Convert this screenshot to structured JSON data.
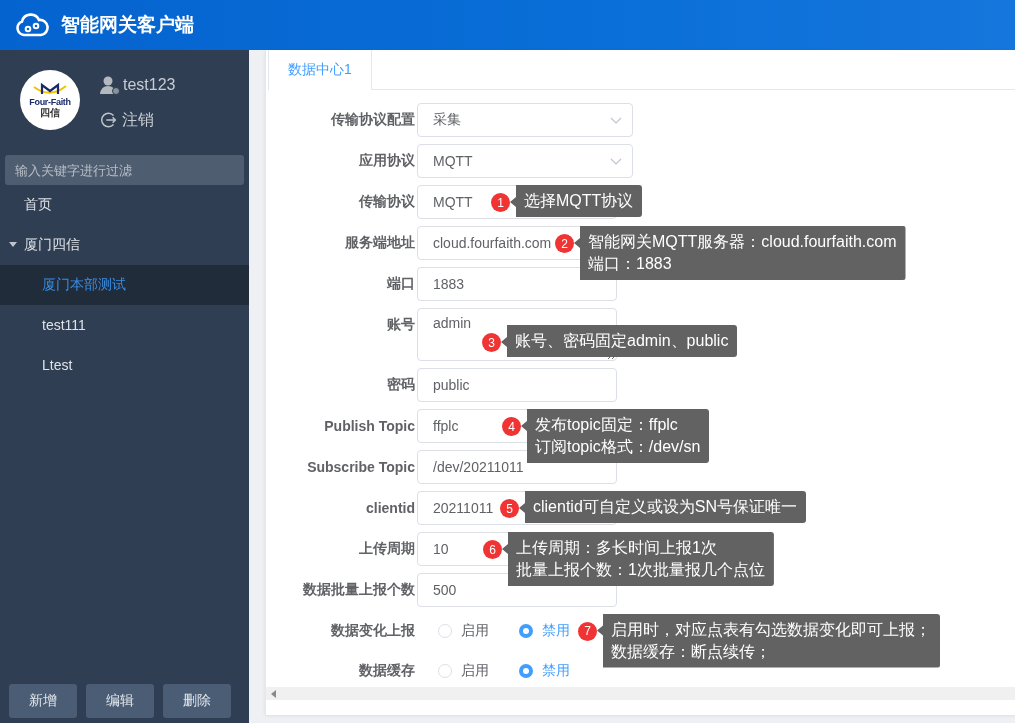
{
  "app": {
    "title": "智能网关客户端"
  },
  "user": {
    "name": "test123",
    "logout": "注销",
    "logo": {
      "name": "Four-Faith",
      "subname": "四信"
    }
  },
  "filter": {
    "placeholder": "输入关键字进行过滤"
  },
  "tree": [
    {
      "label": "首页",
      "selected": false
    },
    {
      "label": "厦门四信",
      "selected": false,
      "expanded": true,
      "children": [
        {
          "label": "厦门本部测试",
          "selected": true
        },
        {
          "label": "test111",
          "selected": false
        },
        {
          "label": "Ltest",
          "selected": false
        }
      ]
    }
  ],
  "buttons": [
    "新增",
    "编辑",
    "删除"
  ],
  "tabs": [
    {
      "label": "数据中心1",
      "selected": true
    }
  ],
  "form": {
    "fields": [
      {
        "label": "传输协议配置",
        "kind": "select",
        "value": "采集"
      },
      {
        "label": "应用协议",
        "kind": "select",
        "value": "MQTT"
      },
      {
        "label": "传输协议",
        "kind": "input",
        "value": "MQTT",
        "note": {
          "number": "1",
          "lines": [
            "选择MQTT协议"
          ]
        }
      },
      {
        "label": "服务端地址",
        "kind": "input",
        "value": "cloud.fourfaith.com",
        "note": {
          "number": "2",
          "lines": [
            "智能网关MQTT服务器：cloud.fourfaith.com",
            "端口：1883"
          ]
        }
      },
      {
        "label": "端口",
        "kind": "input",
        "value": "1883"
      },
      {
        "label": "账号",
        "kind": "textarea",
        "value": "admin",
        "note": {
          "number": "3",
          "lines": [
            "账号、密码固定admin、public"
          ]
        }
      },
      {
        "label": "密码",
        "kind": "input",
        "value": "public"
      },
      {
        "label": "Publish Topic",
        "kind": "input",
        "value": "ffplc",
        "note": {
          "number": "4",
          "lines": [
            "发布topic固定：ffplc",
            "订阅topic格式：/dev/sn"
          ]
        }
      },
      {
        "label": "Subscribe Topic",
        "kind": "input",
        "value": "/dev/20211011"
      },
      {
        "label": "clientid",
        "kind": "input",
        "value": "20211011",
        "note": {
          "number": "5",
          "lines": [
            "clientid可自定义或设为SN号保证唯一"
          ]
        }
      },
      {
        "label": "上传周期",
        "kind": "input",
        "value": "10",
        "note": {
          "number": "6",
          "lines": [
            "上传周期：多长时间上报1次",
            "批量上报个数：1次批量报几个点位"
          ]
        }
      },
      {
        "label": "数据批量上报个数",
        "kind": "input",
        "value": "500"
      },
      {
        "label": "数据变化上报",
        "kind": "radio",
        "options": [
          {
            "label": "启用",
            "selected": false
          },
          {
            "label": "禁用",
            "selected": true
          }
        ],
        "note": {
          "number": "7",
          "lines": [
            "启用时，对应点表有勾选数据变化即可上报；",
            "数据缓存：断点续传；"
          ]
        }
      },
      {
        "label": "数据缓存",
        "kind": "radio",
        "options": [
          {
            "label": "启用",
            "selected": false
          },
          {
            "label": "禁用",
            "selected": true
          }
        ]
      }
    ]
  }
}
